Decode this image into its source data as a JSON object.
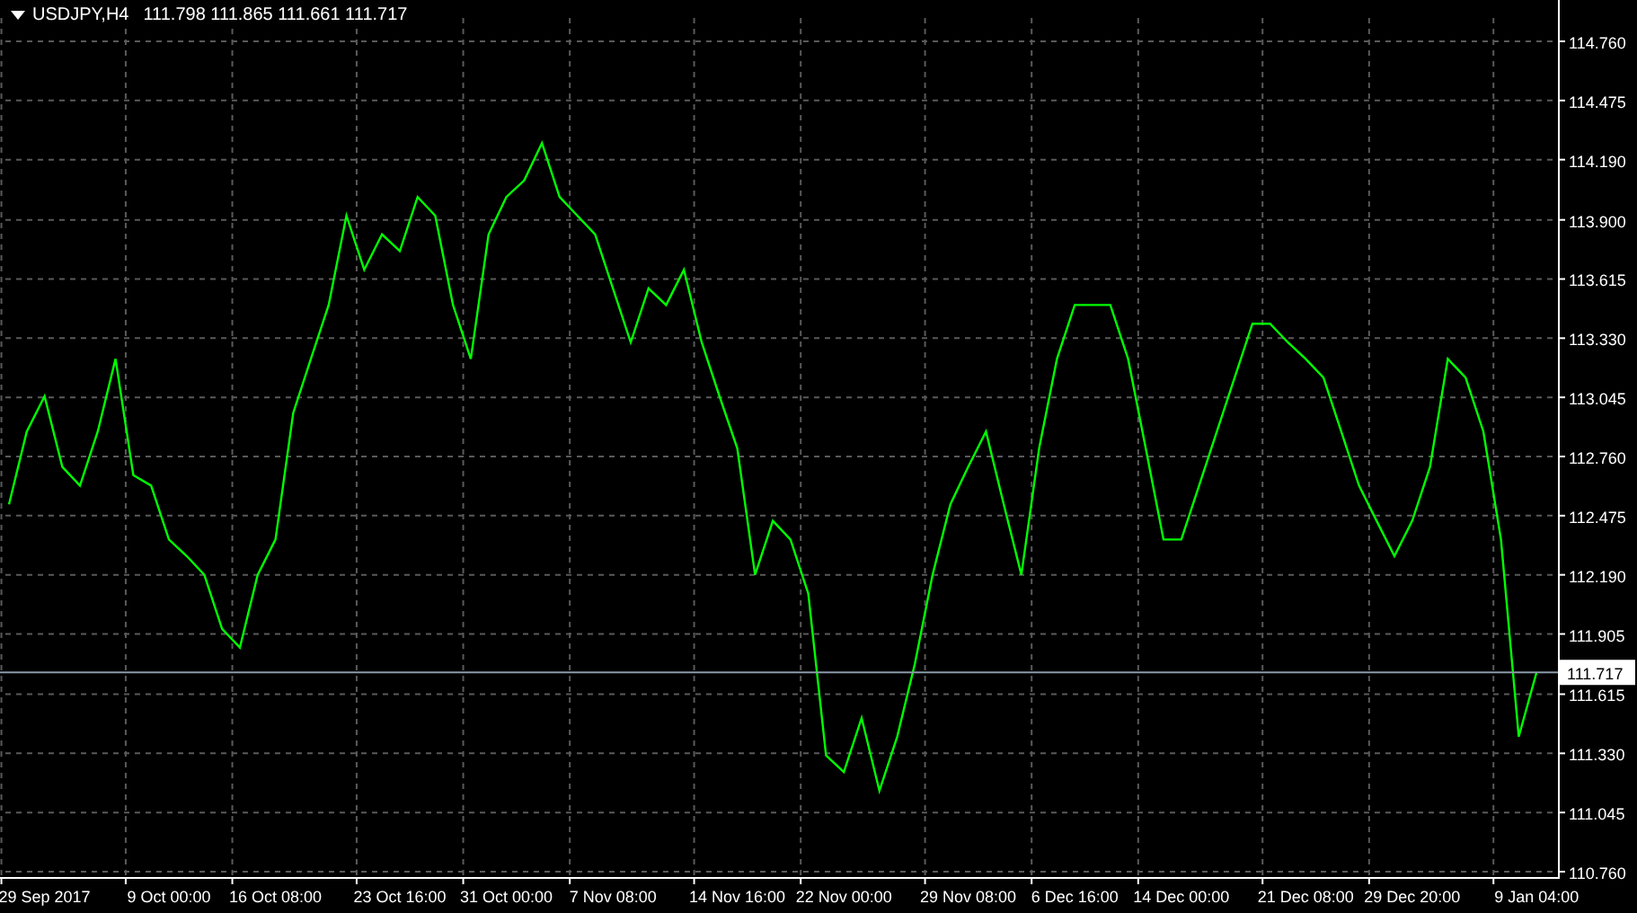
{
  "header": {
    "quote": "111.798 111.865 111.661 111.717"
  },
  "chart_data": {
    "type": "line",
    "grid": true,
    "ylim": [
      110.76,
      114.76
    ],
    "categories": [
      null,
      null,
      "29 Sep 2017",
      null,
      null,
      null,
      null,
      null,
      null,
      "9 Oct 00:00",
      null,
      null,
      null,
      null,
      null,
      "16 Oct 08:00",
      null,
      null,
      null,
      null,
      null,
      null,
      "23 Oct 16:00",
      null,
      null,
      null,
      null,
      null,
      "31 Oct 00:00",
      null,
      null,
      null,
      null,
      null,
      "7 Nov 08:00",
      null,
      null,
      null,
      null,
      null,
      null,
      "14 Nov 16:00",
      null,
      null,
      null,
      null,
      null,
      "22 Nov 00:00",
      null,
      null,
      null,
      null,
      null,
      null,
      "29 Nov 08:00",
      null,
      null,
      null,
      null,
      null,
      "6 Dec 16:00",
      null,
      null,
      null,
      null,
      null,
      "14 Dec 00:00",
      null,
      null,
      null,
      null,
      null,
      null,
      "21 Dec 08:00",
      null,
      null,
      null,
      null,
      null,
      "29 Dec 20:00",
      null,
      null,
      null,
      null,
      null,
      null,
      "9 Jan 04:00"
    ],
    "series": [
      {
        "name": "USDJPY,H4",
        "color": "#00ff00",
        "values": [
          112.53,
          112.88,
          113.05,
          112.71,
          112.62,
          112.88,
          113.23,
          112.67,
          112.62,
          112.36,
          112.28,
          112.19,
          111.93,
          111.84,
          112.19,
          112.36,
          112.97,
          113.23,
          113.49,
          113.92,
          113.66,
          113.83,
          113.75,
          114.01,
          113.92,
          113.49,
          113.23,
          113.83,
          114.01,
          114.09,
          114.27,
          114.01,
          113.92,
          113.83,
          113.57,
          113.31,
          113.57,
          113.49,
          113.66,
          113.31,
          113.05,
          112.8,
          112.19,
          112.45,
          112.36,
          112.1,
          111.32,
          111.24,
          111.5,
          111.15,
          111.41,
          111.76,
          112.19,
          112.53,
          112.71,
          112.88,
          112.53,
          112.19,
          112.8,
          113.23,
          113.49,
          113.49,
          113.49,
          113.23,
          112.8,
          112.36,
          112.36,
          112.62,
          112.88,
          113.14,
          113.4,
          113.4,
          113.31,
          113.23,
          113.14,
          112.88,
          112.62,
          112.45,
          112.28,
          112.45,
          112.71,
          113.23,
          113.14,
          112.88,
          112.36,
          111.41,
          111.72
        ]
      }
    ],
    "yticks": [
      {
        "value": 114.76,
        "label": "114.760"
      },
      {
        "value": 114.475,
        "label": "114.475"
      },
      {
        "value": 114.19,
        "label": "114.190"
      },
      {
        "value": 113.9,
        "label": "113.900"
      },
      {
        "value": 113.615,
        "label": "113.615"
      },
      {
        "value": 113.33,
        "label": "113.330"
      },
      {
        "value": 113.045,
        "label": "113.045"
      },
      {
        "value": 112.76,
        "label": "112.760"
      },
      {
        "value": 112.475,
        "label": "112.475"
      },
      {
        "value": 112.19,
        "label": "112.190"
      },
      {
        "value": 111.905,
        "label": "111.905"
      },
      {
        "value": 111.615,
        "label": "111.615"
      },
      {
        "value": 111.33,
        "label": "111.330"
      },
      {
        "value": 111.045,
        "label": "111.045"
      },
      {
        "value": 110.76,
        "label": "110.760"
      }
    ]
  },
  "current_price": {
    "label": "111.717"
  }
}
